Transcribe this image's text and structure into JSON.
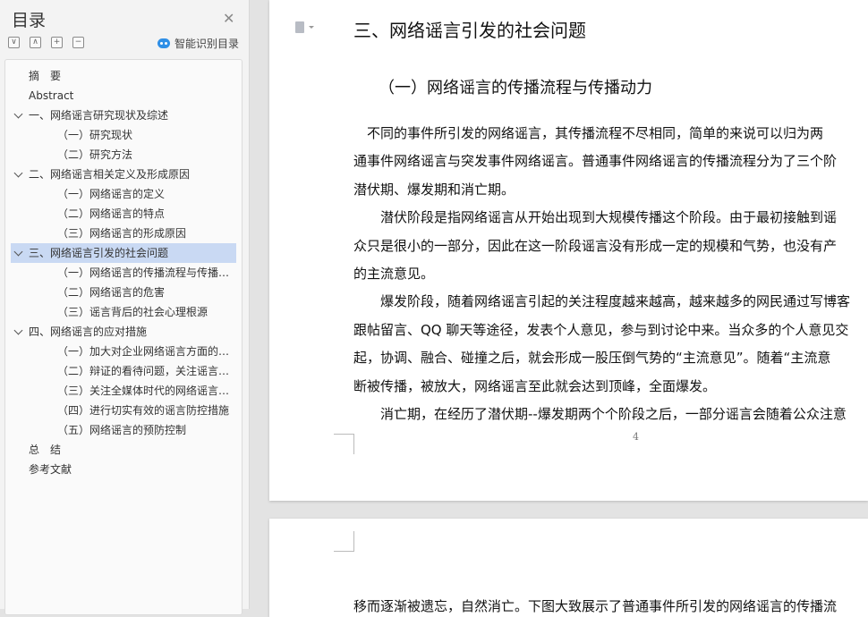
{
  "sidebar": {
    "title": "目录",
    "close_icon": "close-icon",
    "tools": {
      "collapse": "∨",
      "expand": "∧",
      "add": "+",
      "remove": "−"
    },
    "smart_label": "智能识别目录",
    "toc": [
      {
        "label": "摘　要",
        "level": 0
      },
      {
        "label": "Abstract",
        "level": 0
      },
      {
        "label": "一、网络谣言研究现状及综述",
        "level": 1,
        "expanded": true
      },
      {
        "label": "（一）研究现状",
        "level": 2
      },
      {
        "label": "（二）研究方法",
        "level": 2
      },
      {
        "label": "二、网络谣言相关定义及形成原因",
        "level": 1,
        "expanded": true
      },
      {
        "label": "（一）网络谣言的定义",
        "level": 2
      },
      {
        "label": "（二）网络谣言的特点",
        "level": 2
      },
      {
        "label": "（三）网络谣言的形成原因",
        "level": 2
      },
      {
        "label": "三、网络谣言引发的社会问题",
        "level": 1,
        "expanded": true,
        "active": true
      },
      {
        "label": "（一）网络谣言的传播流程与传播动力",
        "level": 2
      },
      {
        "label": "（二）网络谣言的危害",
        "level": 2
      },
      {
        "label": "（三）谣言背后的社会心理根源",
        "level": 2
      },
      {
        "label": "四、网络谣言的应对措施",
        "level": 1,
        "expanded": true
      },
      {
        "label": "（一）加大对企业网络谣言方面的监管",
        "level": 2
      },
      {
        "label": "（二）辩证的看待问题，关注谣言背后的问题",
        "level": 2
      },
      {
        "label": "（三）关注全媒体时代的网络谣言治理",
        "level": 2
      },
      {
        "label": "（四）进行切实有效的谣言防控措施",
        "level": 2
      },
      {
        "label": "（五）网络谣言的预防控制",
        "level": 2
      },
      {
        "label": "总　结",
        "level": 0
      },
      {
        "label": "参考文献",
        "level": 0
      }
    ]
  },
  "document": {
    "heading3": "三、网络谣言引发的社会问题",
    "heading4": "（一）网络谣言的传播流程与传播动力",
    "lines": [
      "　不同的事件所引发的网络谣言，其传播流程不尽相同，简单的来说可以归为两",
      "通事件网络谣言与突发事件网络谣言。普通事件网络谣言的传播流程分为了三个阶",
      "潜伏期、爆发期和消亡期。",
      "　　潜伏阶段是指网络谣言从开始出现到大规模传播这个阶段。由于最初接触到谣",
      "众只是很小的一部分，因此在这一阶段谣言没有形成一定的规模和气势，也没有产",
      "的主流意见。",
      "　　爆发阶段，随着网络谣言引起的关注程度越来越高，越来越多的网民通过写博客",
      "跟帖留言、QQ 聊天等途径，发表个人意见，参与到讨论中来。当众多的个人意见交",
      "起，协调、融合、碰撞之后，就会形成一股压倒气势的“主流意见”。随着“主流意",
      "断被传播，被放大，网络谣言至此就会达到顶峰，全面爆发。",
      "　　消亡期，在经历了潜伏期--爆发期两个个阶段之后，一部分谣言会随着公众注意"
    ],
    "page_number": "4",
    "page2_line": "移而逐渐被遗忘，自然消亡。下图大致展示了普通事件所引发的网络谣言的传播流"
  }
}
